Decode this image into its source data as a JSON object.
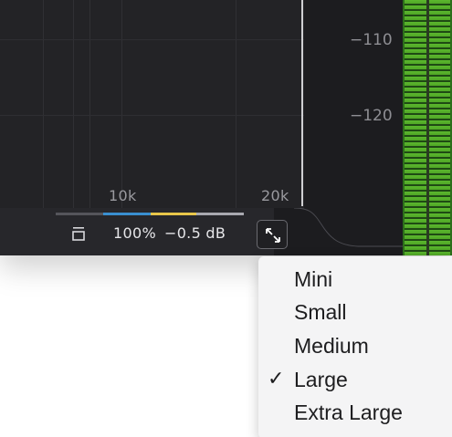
{
  "graph": {
    "freq_labels": [
      "10k",
      "20k"
    ],
    "db_labels": [
      "−110",
      "−120"
    ]
  },
  "toolbar": {
    "zoom": "100%",
    "gain": "−0.5 dB",
    "segment_colors": [
      "#3a8fd0",
      "#e8c64a",
      "#a9a9b0"
    ],
    "collapse_icon": "collapse-icon",
    "resize_icon": "expand-arrows-icon"
  },
  "size_menu": {
    "items": [
      "Mini",
      "Small",
      "Medium",
      "Large",
      "Extra Large"
    ],
    "selected": "Large",
    "check_glyph": "✓"
  },
  "colors": {
    "background": "#232326",
    "meter_green": "#5cb82e",
    "menu_bg": "#f4f4f5"
  }
}
